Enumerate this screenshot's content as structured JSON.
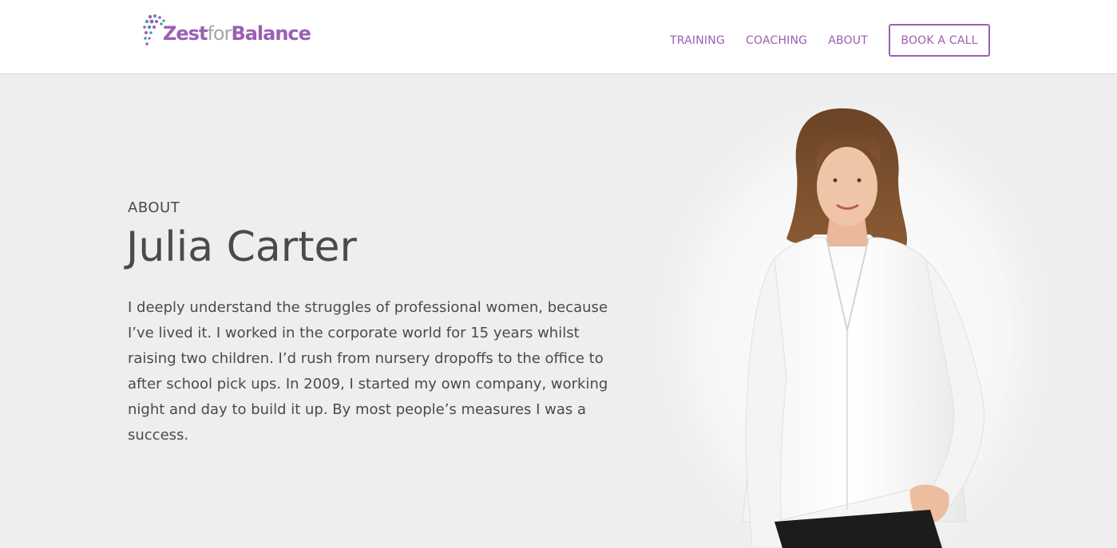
{
  "header": {
    "logo": {
      "part1": "Zest",
      "part2": "for",
      "part3": "Balance",
      "icon": "dots-logo-icon"
    },
    "nav": {
      "items": [
        "TRAINING",
        "COACHING",
        "ABOUT"
      ],
      "cta": "BOOK A CALL"
    }
  },
  "hero": {
    "eyebrow": "ABOUT",
    "title": "Julia Carter",
    "bio": "I deeply understand the struggles of professional women, because I’ve lived it. I worked in the corporate world for 15 years whilst raising two children. I’d rush from nursery dropoffs to the office to after school pick ups. In 2009, I started my own company, working night and day to build it up. By most people’s measures I was a success."
  },
  "colors": {
    "brand": "#9b5fb4",
    "brand_secondary": "#3aa0a0",
    "text": "#4a4a4a",
    "background": "#eeeeee"
  }
}
